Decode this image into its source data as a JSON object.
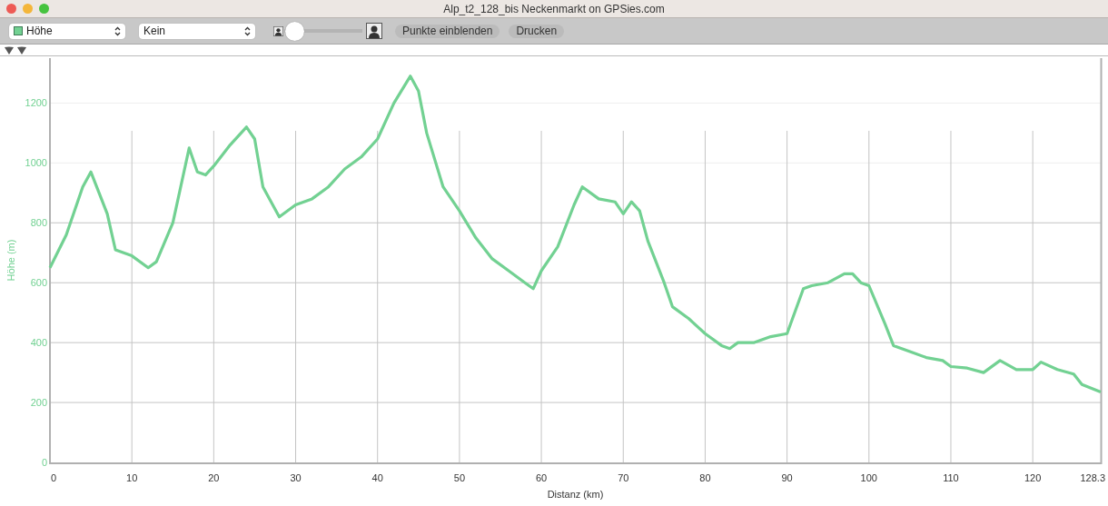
{
  "window": {
    "title": "Alp_t2_128_bis Neckenmarkt on GPSies.com"
  },
  "toolbar": {
    "profile_select": {
      "value": "Höhe"
    },
    "overlay_select": {
      "value": "Kein"
    },
    "zoom_slider": {
      "level": 0
    },
    "buttons": [
      {
        "label": "Punkte einblenden"
      },
      {
        "label": "Drucken"
      }
    ]
  },
  "chart": {
    "chart_data": {
      "type": "line",
      "xlabel": "Distanz (km)",
      "ylabel": "Höhe (m)",
      "xlim": [
        0,
        128.3
      ],
      "ylim": [
        0,
        1350
      ],
      "xticks": [
        0,
        10,
        20,
        30,
        40,
        50,
        60,
        70,
        80,
        90,
        100,
        110,
        120,
        {
          "value": 128.3,
          "label": "128.3"
        }
      ],
      "yticks": [
        0,
        200,
        400,
        600,
        800,
        1000,
        1200
      ],
      "x": [
        0,
        2,
        4,
        5,
        6,
        7,
        8,
        10,
        12,
        13,
        15,
        17,
        18,
        19,
        20,
        22,
        24,
        25,
        26,
        28,
        30,
        32,
        34,
        36,
        38,
        40,
        42,
        44,
        45,
        46,
        48,
        50,
        52,
        54,
        56,
        58,
        59,
        60,
        62,
        64,
        65,
        67,
        69,
        70,
        71,
        72,
        73,
        75,
        76,
        78,
        80,
        82,
        83,
        84,
        86,
        88,
        90,
        92,
        93,
        95,
        97,
        98,
        99,
        100,
        102,
        103,
        105,
        107,
        109,
        110,
        112,
        114,
        116,
        118,
        120,
        121,
        123,
        125,
        126,
        128.3
      ],
      "grid": true,
      "series": [
        {
          "color": "#72d192",
          "values": [
            650,
            760,
            920,
            970,
            900,
            830,
            710,
            690,
            650,
            670,
            800,
            1050,
            970,
            960,
            990,
            1060,
            1120,
            1080,
            920,
            820,
            860,
            880,
            920,
            980,
            1020,
            1080,
            1200,
            1290,
            1240,
            1100,
            920,
            840,
            750,
            680,
            640,
            600,
            580,
            640,
            720,
            860,
            920,
            880,
            870,
            830,
            870,
            840,
            740,
            600,
            520,
            480,
            430,
            390,
            380,
            400,
            400,
            420,
            430,
            580,
            590,
            600,
            630,
            630,
            600,
            590,
            460,
            390,
            370,
            350,
            340,
            320,
            315,
            300,
            340,
            310,
            310,
            335,
            310,
            295,
            260,
            235
          ]
        }
      ]
    }
  }
}
